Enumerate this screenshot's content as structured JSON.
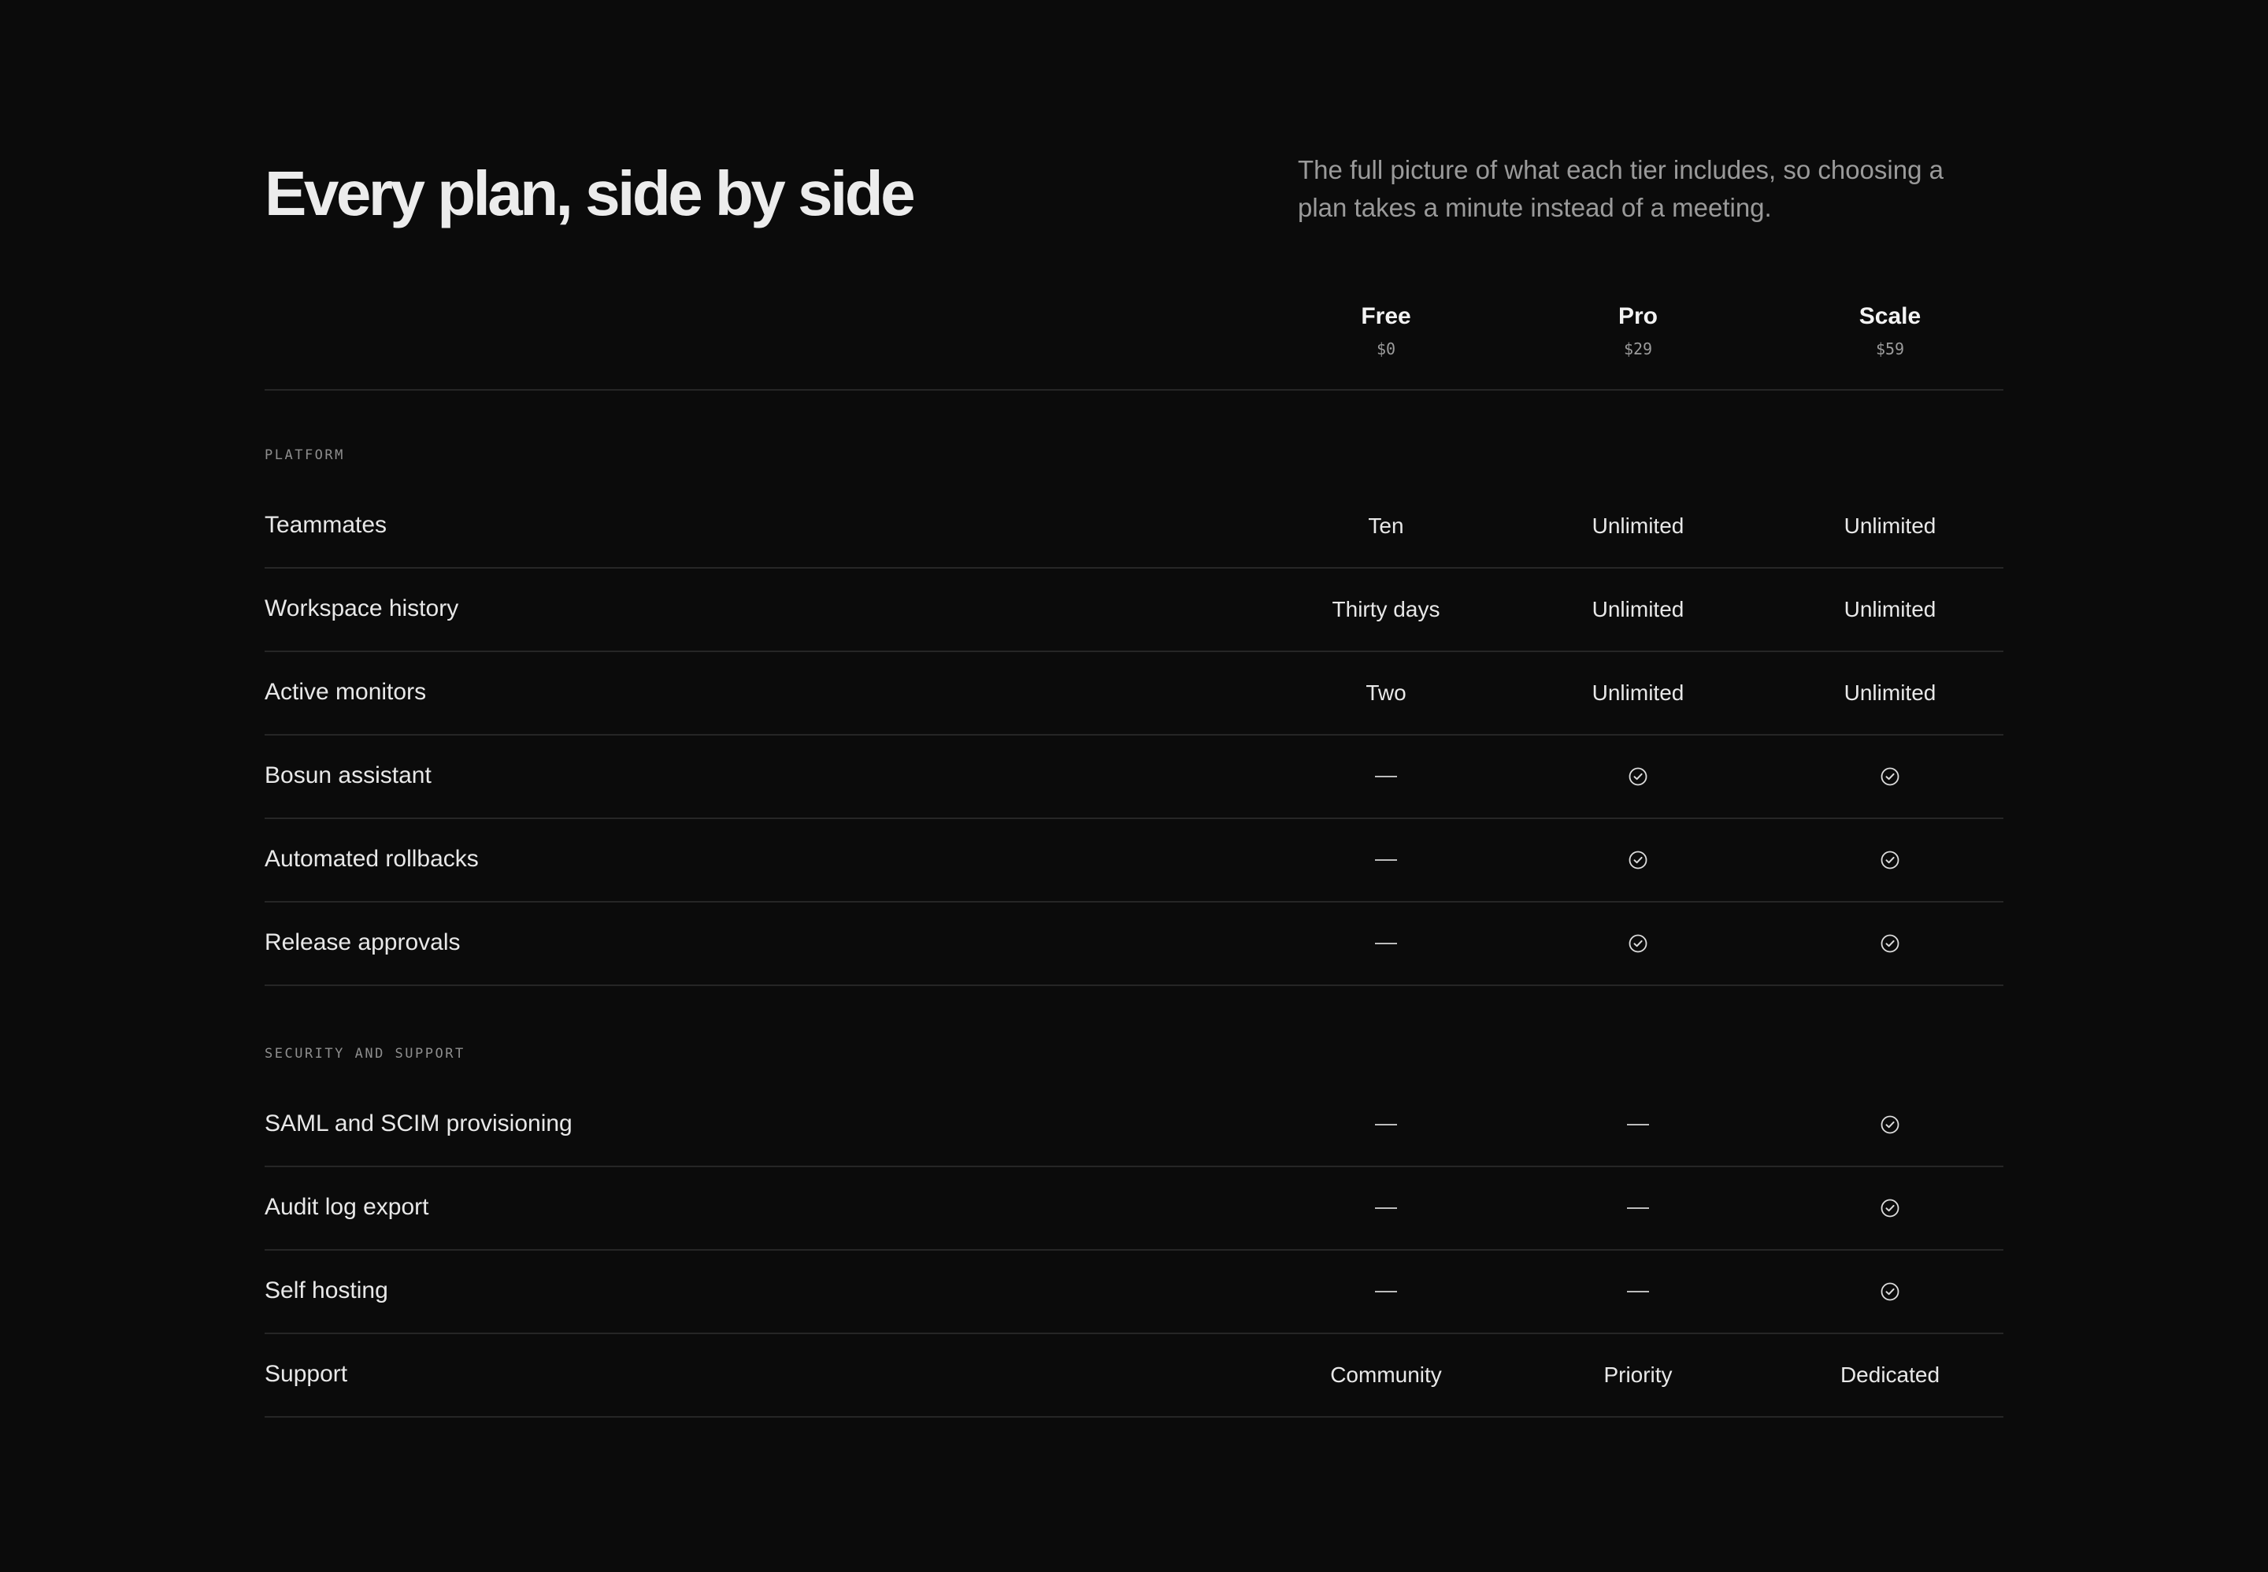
{
  "header": {
    "title": "Every plan, side by side",
    "subtitle": "The full picture of what each tier includes, so choosing a plan takes a minute instead of a meeting."
  },
  "plans": [
    {
      "name": "Free",
      "price": "$0"
    },
    {
      "name": "Pro",
      "price": "$29"
    },
    {
      "name": "Scale",
      "price": "$59"
    }
  ],
  "sections": [
    {
      "label": "PLATFORM",
      "rows": [
        {
          "feature": "Teammates",
          "values": [
            "Ten",
            "Unlimited",
            "Unlimited"
          ]
        },
        {
          "feature": "Workspace history",
          "values": [
            "Thirty days",
            "Unlimited",
            "Unlimited"
          ]
        },
        {
          "feature": "Active monitors",
          "values": [
            "Two",
            "Unlimited",
            "Unlimited"
          ]
        },
        {
          "feature": "Bosun assistant",
          "values": [
            "dash-icon",
            "check-icon",
            "check-icon"
          ]
        },
        {
          "feature": "Automated rollbacks",
          "values": [
            "dash-icon",
            "check-icon",
            "check-icon"
          ]
        },
        {
          "feature": "Release approvals",
          "values": [
            "dash-icon",
            "check-icon",
            "check-icon"
          ]
        }
      ]
    },
    {
      "label": "SECURITY AND SUPPORT",
      "rows": [
        {
          "feature": "SAML and SCIM provisioning",
          "values": [
            "dash-icon",
            "dash-icon",
            "check-icon"
          ]
        },
        {
          "feature": "Audit log export",
          "values": [
            "dash-icon",
            "dash-icon",
            "check-icon"
          ]
        },
        {
          "feature": "Self hosting",
          "values": [
            "dash-icon",
            "dash-icon",
            "check-icon"
          ]
        },
        {
          "feature": "Support",
          "values": [
            "Community",
            "Priority",
            "Dedicated"
          ]
        }
      ]
    }
  ],
  "colors": {
    "background": "#0b0b0b",
    "text": "#ececec",
    "muted": "#9a9a9a",
    "divider": "#262626"
  }
}
